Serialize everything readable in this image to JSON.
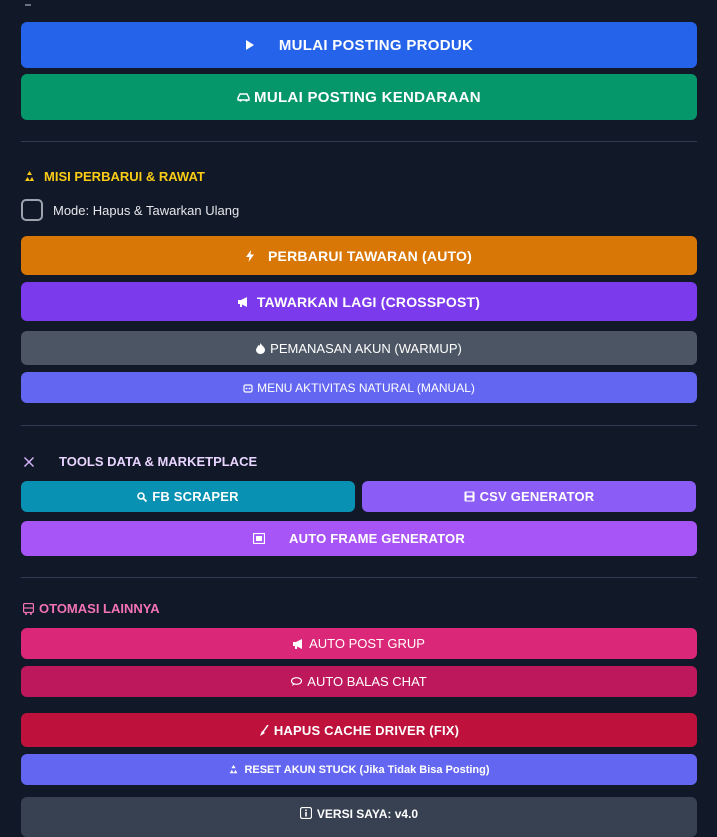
{
  "posting": {
    "produk_label": "MULAI POSTING PRODUK",
    "kendaraan_label": "MULAI POSTING KENDARAAN"
  },
  "misi": {
    "heading": "MISI PERBARUI & RAWAT",
    "mode_label": "Mode: Hapus & Tawarkan Ulang",
    "perbarui_label": "PERBARUI TAWARAN (AUTO)",
    "tawarkan_label": "TAWARKAN LAGI (CROSSPOST)",
    "pemanasan_label": "PEMANASAN AKUN (WARMUP)",
    "aktivitas_label": "MENU AKTIVITAS NATURAL (MANUAL)"
  },
  "tools": {
    "heading": "TOOLS DATA & MARKETPLACE",
    "fb_scraper_label": "FB SCRAPER",
    "csv_label": "CSV GENERATOR",
    "auto_frame_label": "AUTO FRAME GENERATOR"
  },
  "otomasi": {
    "heading": "OTOMASI LAINNYA",
    "auto_post_label": "AUTO POST GRUP",
    "auto_balas_label": "AUTO BALAS CHAT",
    "hapus_cache_label": "HAPUS CACHE DRIVER (FIX)",
    "reset_label": "RESET AKUN STUCK (Jika Tidak Bisa Posting)",
    "versi_label": "VERSI SAYA: v4.0"
  },
  "colors": {
    "produk": "#2563eb",
    "kendaraan": "#059669",
    "perbarui": "#d97706",
    "tawarkan": "#7c3aed",
    "pemanasan": "#4b5563",
    "aktivitas": "#6366f1",
    "fb_scraper": "#0891b2",
    "csv": "#8b5cf6",
    "auto_frame": "#a855f7",
    "auto_post": "#db2777",
    "auto_balas": "#be185d",
    "hapus_cache": "#be123c",
    "reset": "#6366f1",
    "versi": "#374151",
    "heading_misi": "#facc15",
    "heading_tools": "#e9d5ff",
    "heading_otomasi": "#f472b6"
  },
  "icons": {
    "produk": "play-icon",
    "kendaraan": "car-icon",
    "misi": "recycle-icon",
    "perbarui": "lightning-icon",
    "tawarkan": "megaphone-icon",
    "pemanasan": "fire-icon",
    "aktivitas": "robot-icon",
    "tools": "wrench-icon",
    "fb_scraper": "magnifier-icon",
    "csv": "save-icon",
    "auto_frame": "frame-icon",
    "otomasi": "bus-icon",
    "auto_post": "megaphone-icon",
    "auto_balas": "speech-bubble-icon",
    "hapus_cache": "broom-icon",
    "reset": "recycle-icon",
    "versi": "info-icon"
  }
}
